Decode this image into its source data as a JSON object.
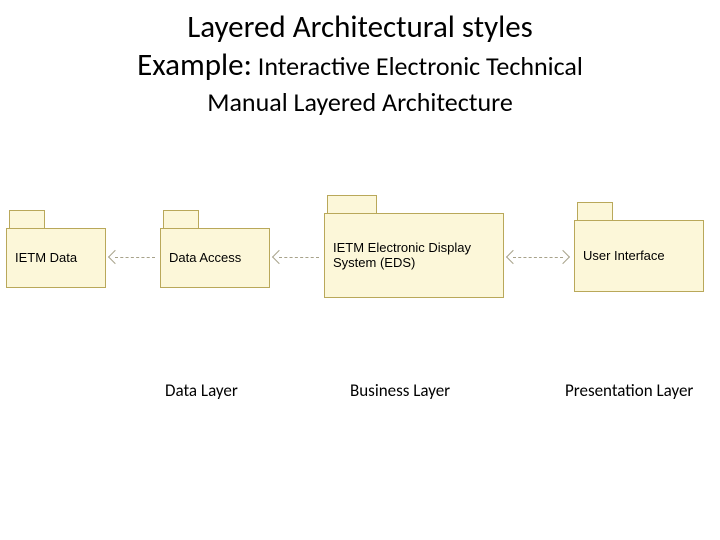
{
  "title": {
    "line1": "Layered Architectural styles",
    "line2_prefix": "Example:",
    "line2_rest": " Interactive Electronic Technical",
    "line3": "Manual Layered Architecture"
  },
  "folders": {
    "data": "IETM Data",
    "access": "Data Access",
    "eds": "IETM Electronic Display System (EDS)",
    "ui": "User Interface"
  },
  "labels": {
    "data_layer": "Data Layer",
    "business_layer": "Business Layer",
    "presentation_layer": "Presentation Layer"
  }
}
